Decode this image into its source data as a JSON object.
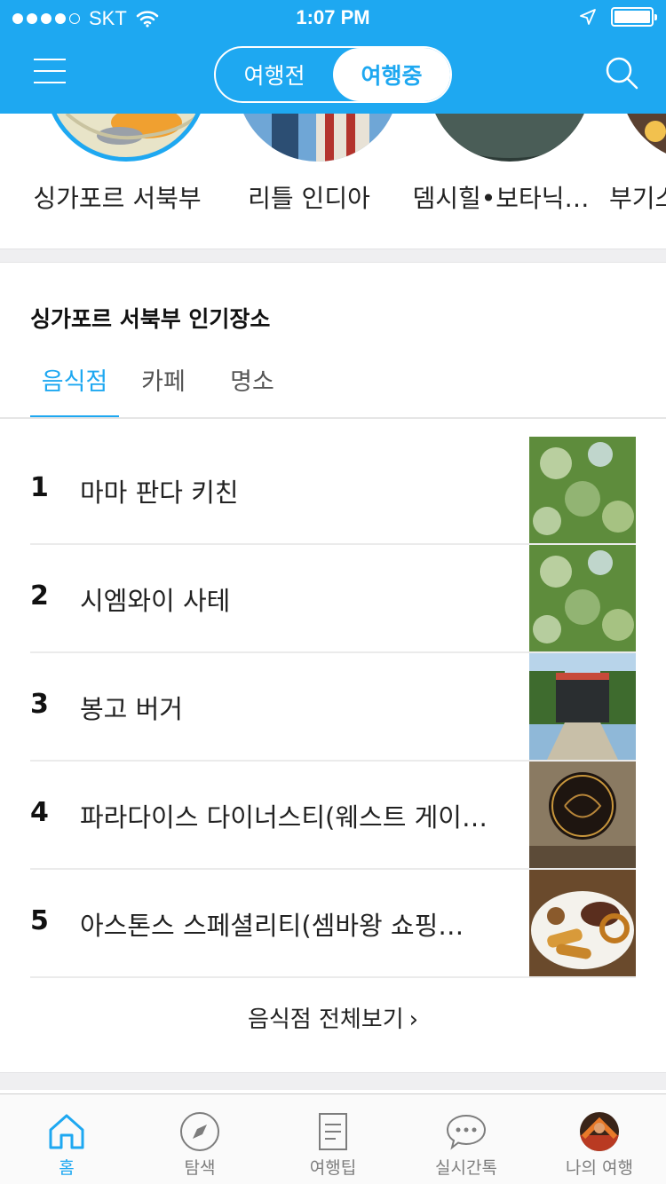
{
  "status_bar": {
    "carrier": "SKT",
    "time": "1:07 PM"
  },
  "header": {
    "segments": [
      {
        "label": "여행전",
        "active": false
      },
      {
        "label": "여행중",
        "active": true
      }
    ],
    "accent_color": "#1ea8f1"
  },
  "areas": [
    {
      "name": "싱가포르 서북부",
      "selected": true
    },
    {
      "name": "리틀 인디아",
      "selected": false
    },
    {
      "name": "뎀시힐•보타닉…",
      "selected": false
    },
    {
      "name": "부기스",
      "selected": false
    }
  ],
  "popular": {
    "title": "싱가포르 서북부 인기장소",
    "tabs": [
      {
        "label": "음식점",
        "active": true
      },
      {
        "label": "카페",
        "active": false
      },
      {
        "label": "명소",
        "active": false
      }
    ],
    "items": [
      {
        "rank": "1",
        "name": "마마 판다 키친"
      },
      {
        "rank": "2",
        "name": "시엠와이 사테"
      },
      {
        "rank": "3",
        "name": "봉고 버거"
      },
      {
        "rank": "4",
        "name": "파라다이스 다이너스티(웨스트 게이…"
      },
      {
        "rank": "5",
        "name": "아스톤스 스페셜리티(셈바왕 쇼핑…"
      }
    ],
    "view_all_label": "음식점 전체보기",
    "view_all_chevron": "›"
  },
  "tabbar": {
    "items": [
      {
        "label": "홈",
        "icon": "home-icon",
        "active": true
      },
      {
        "label": "탐색",
        "icon": "compass-icon",
        "active": false
      },
      {
        "label": "여행팁",
        "icon": "document-icon",
        "active": false
      },
      {
        "label": "실시간톡",
        "icon": "chat-bubble-icon",
        "active": false
      },
      {
        "label": "나의 여행",
        "icon": "avatar",
        "active": false
      }
    ]
  }
}
